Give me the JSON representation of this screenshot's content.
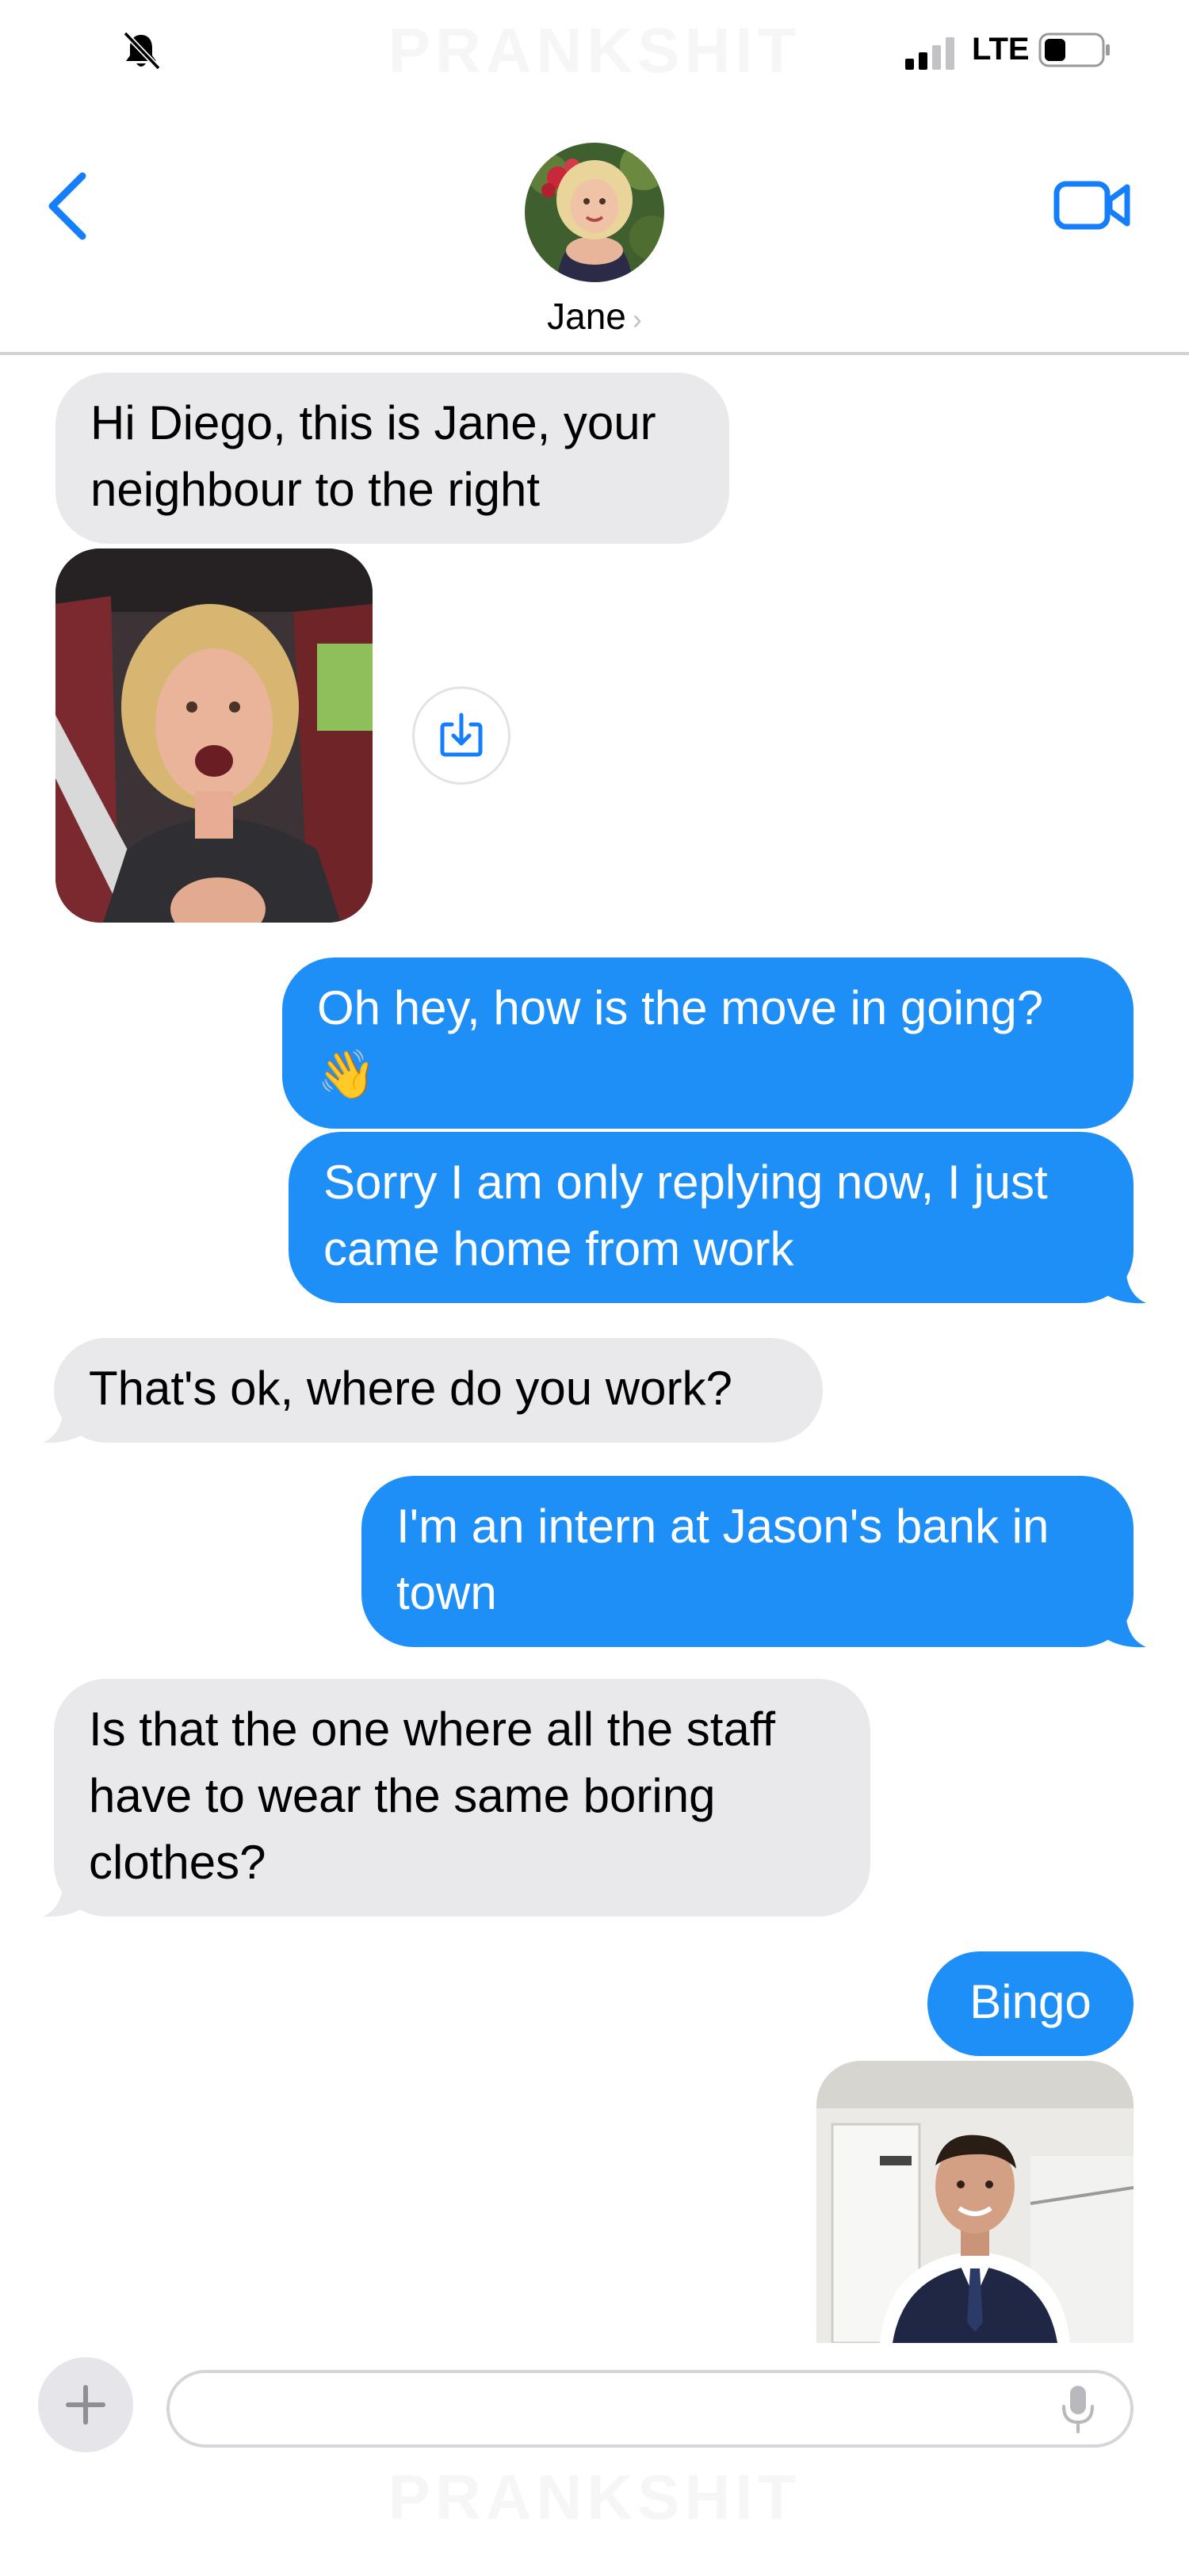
{
  "watermark": "PRANKSHIT",
  "status_bar": {
    "carrier": "LTE"
  },
  "header": {
    "contact_name": "Jane",
    "name_chevron": "›"
  },
  "messages": [
    {
      "sender": "received",
      "text": "Hi Diego, this is Jane, your\nneighbour to the right"
    },
    {
      "sender": "received",
      "type": "photo"
    },
    {
      "sender": "sent",
      "text": "Oh hey, how is the move in going?\n👋"
    },
    {
      "sender": "sent",
      "text": "Sorry I am only replying now, I just\ncame home from work"
    },
    {
      "sender": "received",
      "text": "That's ok, where do you work?"
    },
    {
      "sender": "sent",
      "text": "I'm an intern at Jason's bank in\ntown"
    },
    {
      "sender": "received",
      "text": "Is that the one where all the staff\nhave to wear the same boring\nclothes?"
    },
    {
      "sender": "sent",
      "text": "Bingo"
    },
    {
      "sender": "sent",
      "type": "photo"
    }
  ],
  "input": {
    "placeholder": ""
  },
  "icons": {
    "status": [
      "bell-slash-icon",
      "signal-icon",
      "battery-icon"
    ],
    "header": [
      "chevron-left-icon",
      "video-camera-icon"
    ],
    "message": [
      "save-download-icon"
    ],
    "input": [
      "plus-icon",
      "microphone-icon"
    ]
  },
  "colors": {
    "accent": "#1f8ff8",
    "ios_blue": "#147efb",
    "received_bubble": "#e9e9eb",
    "separator": "#d2d2d6"
  }
}
